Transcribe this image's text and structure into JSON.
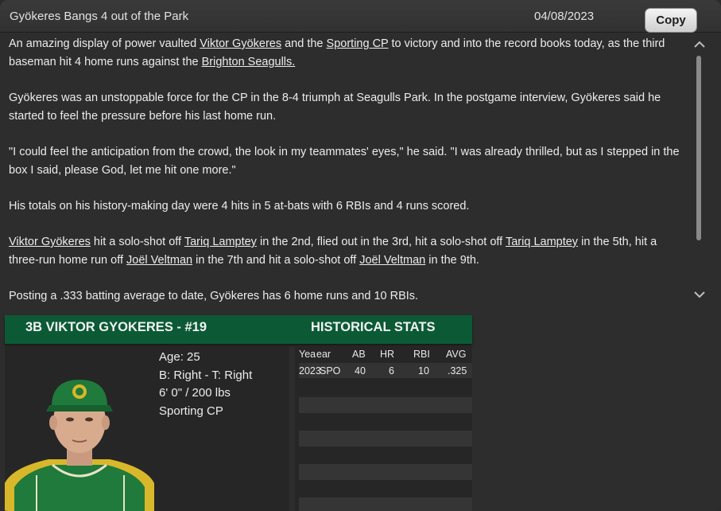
{
  "header": {
    "title": "Gyökeres Bangs 4 out of the Park",
    "date": "04/08/2023",
    "copy_label": "Copy"
  },
  "article": {
    "p1": [
      {
        "text": "An amazing display of power vaulted ",
        "link": false
      },
      {
        "text": "Viktor Gyökeres",
        "link": true
      },
      {
        "text": " and the ",
        "link": false
      },
      {
        "text": "Sporting CP",
        "link": true
      },
      {
        "text": " to victory and into the record books today, as the third baseman hit 4 home runs against the ",
        "link": false
      },
      {
        "text": "Brighton Seagulls.",
        "link": true
      }
    ],
    "p2": "Gyökeres was an unstoppable force for the CP in the 8-4 triumph at Seagulls Park. In the postgame interview, Gyökeres said he started to feel the pressure before his last home run.",
    "p3": "\"I could feel the anticipation from the crowd, the look in my teammates' eyes,\" he said. \"I was already thrilled, but as I stepped in the box I said, please God, let me hit one more.\"",
    "p4": "His totals on his history-making day were 4 hits in 5 at-bats with 6 RBIs and 4 runs scored.",
    "p5": [
      {
        "text": "Viktor Gyökeres",
        "link": true
      },
      {
        "text": " hit a solo-shot off ",
        "link": false
      },
      {
        "text": "Tariq Lamptey",
        "link": true
      },
      {
        "text": " in the 2nd, flied out in the 3rd, hit a solo-shot off ",
        "link": false
      },
      {
        "text": "Tariq Lamptey",
        "link": true
      },
      {
        "text": " in the 5th, hit a three-run home run off ",
        "link": false
      },
      {
        "text": "Joël Veltman",
        "link": true
      },
      {
        "text": " in the 7th and hit a solo-shot off ",
        "link": false
      },
      {
        "text": "Joël Veltman",
        "link": true
      },
      {
        "text": " in the 9th.",
        "link": false
      }
    ],
    "p6": "Posting a .333 batting average to date, Gyökeres has 6 home runs and 10 RBIs."
  },
  "scroll": {
    "up_icon": "chevron-up-icon",
    "down_icon": "chevron-down-icon"
  },
  "player": {
    "name_line": "3B VIKTOR GYOKERES - #19",
    "age": "Age: 25",
    "bats_throws": "B: Right - T: Right",
    "size": "6' 0\" / 200 lbs",
    "team": "Sporting CP"
  },
  "historical": {
    "title": "HISTORICAL STATS",
    "columns": [
      "Yea",
      "ear",
      "AB",
      "HR",
      "RBI",
      "AVG"
    ],
    "rows": [
      {
        "year": "2023",
        "team": "SPO",
        "ab": "40",
        "hr": "6",
        "rbi": "10",
        "avg": ".325"
      }
    ]
  },
  "colors": {
    "accent_green": "#0b5a35",
    "background": "#2d2d2d"
  }
}
